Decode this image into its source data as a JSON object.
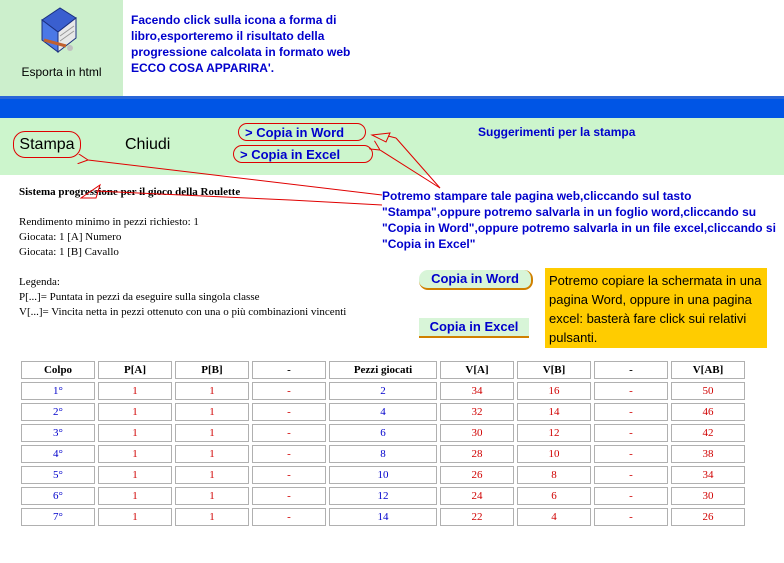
{
  "export": {
    "label": "Esporta in html",
    "icon": "book-icon",
    "intro": "Facendo click sulla icona a forma di\nlibro,esporteremo il risultato della\nprogressione calcolata in formato web\n        ECCO COSA APPARIRA'."
  },
  "toolbar": {
    "stampa": "Stampa",
    "chiudi": "Chiudi",
    "copia_word": "> Copia in Word",
    "copia_excel": "> Copia in Excel",
    "suggerimenti": "Suggerimenti per la stampa"
  },
  "document": {
    "title": "Sistema progressione per il gioco della Roulette",
    "rendimento": "Rendimento minimo in pezzi richiesto: 1",
    "giocata_a": "Giocata: 1 [A] Numero",
    "giocata_b": "Giocata: 1 [B] Cavallo",
    "legenda": "Legenda:",
    "legenda_p": "P[...]= Puntata in pezzi da eseguire sulla singola classe",
    "legenda_v": "V[...]= Vincita netta in pezzi ottenuto con una o più combinazioni vincenti"
  },
  "notes": {
    "stampa_note": "Potremo stampare tale pagina web,cliccando sul tasto \"Stampa\",oppure potremo salvarla in un foglio word,cliccando su \"Copia in Word\",oppure potremo salvarla in un file excel,cliccando si \"Copia in Excel\"",
    "copia_word_btn": "Copia in Word",
    "copia_excel_btn": "Copia in Excel",
    "tip": "Potremo copiare la schermata in una pagina Word, oppure in una pagina excel: basterà fare click sui relativi pulsanti."
  },
  "table": {
    "headers": [
      "Colpo",
      "P[A]",
      "P[B]",
      "-",
      "Pezzi giocati",
      "V[A]",
      "V[B]",
      "-",
      "V[AB]"
    ],
    "rows": [
      [
        "1°",
        "1",
        "1",
        "-",
        "2",
        "34",
        "16",
        "-",
        "50"
      ],
      [
        "2°",
        "1",
        "1",
        "-",
        "4",
        "32",
        "14",
        "-",
        "46"
      ],
      [
        "3°",
        "1",
        "1",
        "-",
        "6",
        "30",
        "12",
        "-",
        "42"
      ],
      [
        "4°",
        "1",
        "1",
        "-",
        "8",
        "28",
        "10",
        "-",
        "38"
      ],
      [
        "5°",
        "1",
        "1",
        "-",
        "10",
        "26",
        "8",
        "-",
        "34"
      ],
      [
        "6°",
        "1",
        "1",
        "-",
        "12",
        "24",
        "6",
        "-",
        "30"
      ],
      [
        "7°",
        "1",
        "1",
        "-",
        "14",
        "22",
        "4",
        "-",
        "26"
      ]
    ]
  },
  "colors": {
    "accent_blue": "#0000cc",
    "value_red": "#d00000",
    "toolbar_green": "#ccf5cc",
    "bar_blue": "#0055e5",
    "tip_yellow": "#ffcc00"
  }
}
